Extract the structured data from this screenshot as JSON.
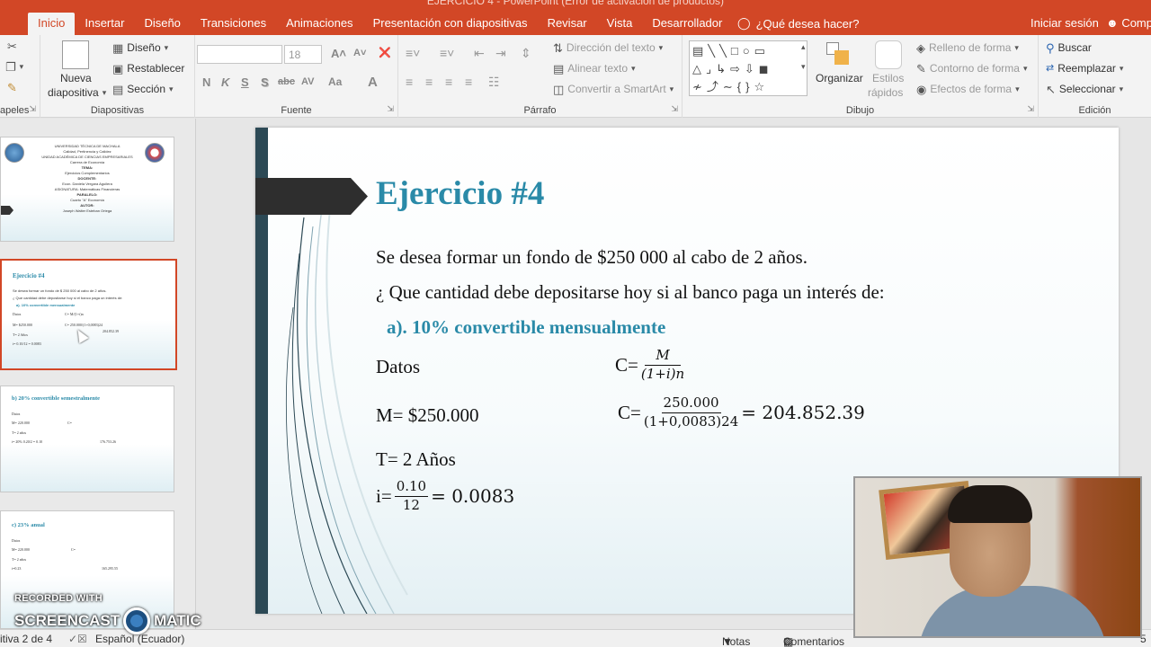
{
  "window": {
    "title": "EJERCICIO 4 - PowerPoint (Error de activación de productos)",
    "tabs": [
      "Inicio",
      "Insertar",
      "Diseño",
      "Transiciones",
      "Animaciones",
      "Presentación con diapositivas",
      "Revisar",
      "Vista",
      "Desarrollador"
    ],
    "active_tab": "Inicio",
    "tell_me": "¿Qué desea hacer?",
    "sign_in": "Iniciar sesión",
    "share": "Comp"
  },
  "ribbon": {
    "portapapeles": {
      "label": "apeles"
    },
    "diapositivas": {
      "label": "Diapositivas",
      "nueva_line1": "Nueva",
      "nueva_line2": "diapositiva",
      "diseno": "Diseño",
      "restablecer": "Restablecer",
      "seccion": "Sección"
    },
    "fuente": {
      "label": "Fuente",
      "font_size": "18",
      "buttons": [
        "N",
        "K",
        "S",
        "S",
        "abc",
        "AV",
        "Aa",
        "A"
      ]
    },
    "parrafo": {
      "label": "Párrafo",
      "direccion": "Dirección del texto",
      "alinear": "Alinear texto",
      "smartart": "Convertir a SmartArt"
    },
    "dibujo": {
      "label": "Dibujo",
      "organizar": "Organizar",
      "estilos_line1": "Estilos",
      "estilos_line2": "rápidos",
      "relleno": "Relleno de forma",
      "contorno": "Contorno de forma",
      "efectos": "Efectos de forma"
    },
    "edicion": {
      "label": "Edición",
      "buscar": "Buscar",
      "reemplazar": "Reemplazar",
      "seleccionar": "Seleccionar"
    }
  },
  "thumbnails": {
    "t1": {
      "lines": [
        "UNIVERSIDAD TÉCNICA DE MACHALA",
        "Calidad, Pertinencia y Calidez",
        "UNIDAD ACADÉMICA DE CIENCIAS EMPRESARIALES",
        "Carrera de Economía",
        "TEMA:",
        "Ejercicios Complementarios",
        "DOCENTE:",
        "Econ. Daniela Vergara Aguilera",
        "ASIGNATURA: Matemáticas Financieras",
        "PARALELO:",
        "Cuarto \"A\" Economía",
        "AUTOR:",
        "Joseph Walter Esteban Ortega"
      ]
    },
    "t2": {
      "title": "Ejercicio #4",
      "l1": "Se desea formar un fondo de $ 250 000 al cabo de 2 años.",
      "l2": "¿ Que cantidad debe depositarse hoy si el banco paga un interés de:",
      "l3": "a). 10% convertible mensualmente",
      "datos": "Datos",
      "m": "M= $250.000",
      "t": "T= 2 Años",
      "i": "i= 0.10/12 = 0.0083",
      "c1": "C= M/(1+i)n",
      "c2": "C= 250.000/(1+0,0083)24",
      "r": "204.852.39"
    },
    "t3": {
      "title": "b) 20% convertible semestralmente",
      "datos": "Datos",
      "m": "M= 220.000",
      "t": "T= 2 años",
      "i": "i= 20% 0.20/2 = 0.10",
      "c": "C=",
      "r": "176.753.26"
    },
    "t4": {
      "title": "c) 23% anual",
      "datos": "Datos",
      "m": "M= 220.000",
      "t": "T= 2 años",
      "i": "i=0.23",
      "c": "C=",
      "r": "165.295.55"
    }
  },
  "slide": {
    "title": "Ejercicio #4",
    "line1": "Se desea formar un fondo de $250 000 al cabo de 2 años.",
    "line2": "¿ Que cantidad debe depositarse hoy si al banco paga un interés de:",
    "line3": "a). 10% convertible mensualmente",
    "datos": "Datos",
    "m": "M= $250.000",
    "t": "T= 2 Años",
    "i_label": "i=",
    "i_num": "0.10",
    "i_den": "12",
    "i_result": "= 0.0083",
    "c1_label": "C=",
    "c1_num": "M",
    "c1_den": "(1+i)n",
    "c2_label": "C=",
    "c2_num": "250.000",
    "c2_den": "(1+0,0083)24",
    "c2_result": "= 204.852.39"
  },
  "status": {
    "slide_info": "itiva 2 de 4",
    "language": "Español (Ecuador)",
    "notes": "Notas",
    "comments": "Comentarios",
    "zoom": "5"
  },
  "watermark": {
    "top": "RECORDED WITH",
    "left": "SCREENCAST",
    "right": "MATIC"
  },
  "colors": {
    "accent": "#d24726",
    "slide_title": "#2a8aa8",
    "slide_bar": "#2c4955"
  }
}
